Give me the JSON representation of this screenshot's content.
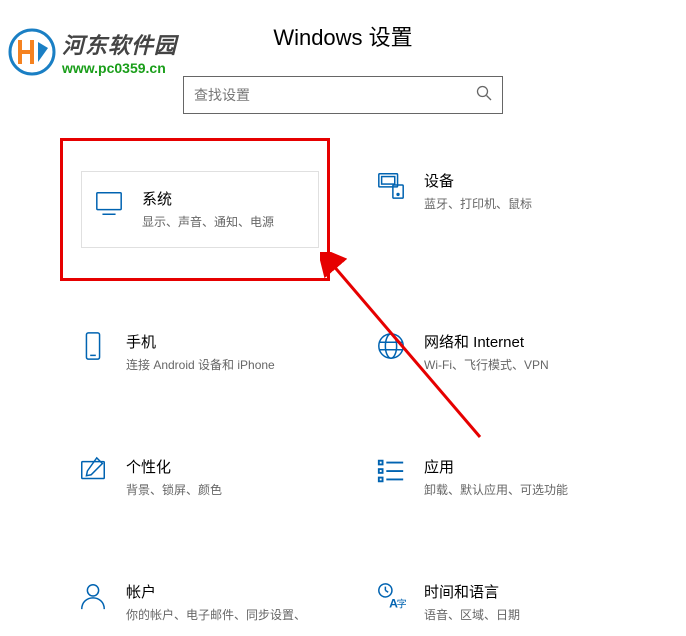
{
  "watermark": {
    "title": "河东软件园",
    "url": "www.pc0359.cn"
  },
  "page_title": "Windows 设置",
  "search": {
    "placeholder": "查找设置"
  },
  "tiles": [
    {
      "id": "system",
      "title": "系统",
      "desc": "显示、声音、通知、电源",
      "highlighted": true
    },
    {
      "id": "devices",
      "title": "设备",
      "desc": "蓝牙、打印机、鼠标",
      "highlighted": false
    },
    {
      "id": "phone",
      "title": "手机",
      "desc": "连接 Android 设备和 iPhone",
      "highlighted": false
    },
    {
      "id": "network",
      "title": "网络和 Internet",
      "desc": "Wi-Fi、飞行模式、VPN",
      "highlighted": false
    },
    {
      "id": "personalization",
      "title": "个性化",
      "desc": "背景、锁屏、颜色",
      "highlighted": false
    },
    {
      "id": "apps",
      "title": "应用",
      "desc": "卸载、默认应用、可选功能",
      "highlighted": false
    },
    {
      "id": "accounts",
      "title": "帐户",
      "desc": "你的帐户、电子邮件、同步设置、",
      "highlighted": false
    },
    {
      "id": "time",
      "title": "时间和语言",
      "desc": "语音、区域、日期",
      "highlighted": false
    }
  ]
}
